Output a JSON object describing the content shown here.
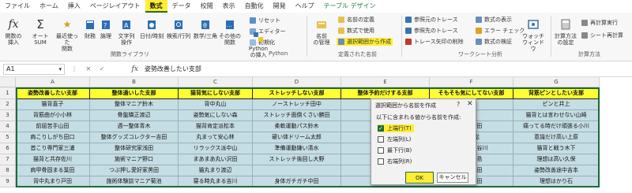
{
  "menu": {
    "items": [
      "ファイル",
      "ホーム",
      "挿入",
      "ページレイアウト",
      "数式",
      "データ",
      "校閲",
      "表示",
      "自動化",
      "開発",
      "ヘルプ",
      "テーブル デザイン"
    ],
    "active_index": 4
  },
  "ribbon": {
    "insert_function": "関数の\n挿入",
    "autosum": "オート\nSUM",
    "recent": "最近使った\n関数",
    "financial": "財務",
    "logical": "論理",
    "text": "文字列\n操作",
    "datetime": "日付/時刻",
    "lookup": "検索/行列",
    "math": "数学/三角",
    "more": "その他の\n関数",
    "group_library": "関数ライブラリ",
    "lambda_items": [
      "リセット",
      "エディター",
      "初期化"
    ],
    "python_insert": "Python\nの挿入",
    "group_python": "Python",
    "name_manager": "名前\nの管理",
    "define_name": "名前の定義",
    "use_in_formula": "数式で使用",
    "create_from_selection": "選択範囲から作成",
    "group_names": "定義された名前",
    "trace_precedents": "参照元のトレース",
    "trace_dependents": "参照先のトレース",
    "remove_arrows": "トレース矢印の削除",
    "show_formulas": "数式の表示",
    "error_check": "エラー チェック",
    "evaluate": "数式の検証",
    "watch": "ウォッチ\nウィンドウ",
    "group_audit": "ワークシート分析",
    "calc_options": "計算方法\nの設定",
    "calc_now": "再計算実行",
    "calc_sheet": "シート再計算",
    "group_calc": "計算方法"
  },
  "formula_bar": {
    "name_box": "A1",
    "fx": "fx",
    "buttons": "⋮ ✕ ✓",
    "value": "姿勢改善したい支部"
  },
  "grid": {
    "columns": [
      "A",
      "B",
      "C",
      "D",
      "E",
      "F",
      "G"
    ],
    "rows": [
      "1",
      "2",
      "3",
      "4",
      "5",
      "6",
      "7",
      "8",
      "9"
    ],
    "headers": [
      "姿勢改善したい支部",
      "整体通いした支部",
      "猫背気にしない支部",
      "ストレッチしない支部",
      "整体予約だけする支部",
      "そもそも気にしてない支部",
      "背筋ピンとしたい支部"
    ],
    "data": [
      [
        "猫背直子",
        "整体マニア鈴木",
        "背中丸山",
        "ノーストレッチ田中",
        "",
        "後藤",
        "ピンと井上"
      ],
      [
        "背筋曲が小小林",
        "骨盤矯正渡辺",
        "姿勢気にしない森",
        "ストレッチ面倒くさい勝田",
        "",
        "猫背",
        "猫背とは言わせない山崎"
      ],
      [
        "前屈苦手山田",
        "週一整体青木",
        "猫背肯定派松本",
        "柔軟運動パス鈴木",
        "カウン",
        "して猫田",
        "痛ってる時だけ頑張る小川"
      ],
      [
        "肩こりしがち田口",
        "整体グッズコレクター吉田",
        "丸まって安心林",
        "硬い体ドリーム太郎",
        "",
        "伸小松",
        "意識だけ高い上原"
      ],
      [
        "首こり専門家三浦",
        "整体研究家浅田",
        "リラックス派中山",
        "準備運動嫌い清水",
        "いつか",
        "計議員長谷川",
        "猫背と戦う木下"
      ],
      [
        "猫背と共存佐川",
        "施術マニア野口",
        "まあまあ丸い沢田",
        "ストレッチ後回し大野",
        "",
        "猫背小島",
        "理想は高い久保"
      ],
      [
        "肩甲骨固まる葉田",
        "つぶ押し愛好家黒田",
        "猫丸まり渡辺",
        "",
        "",
        "いい猫田",
        "姿勢改善途中吉本"
      ],
      [
        "背中丸まり戸田",
        "施術体験談マニア菊池",
        "寝る時丸まる吉川",
        "身体ガチガチ中田",
        "",
        "行政高田",
        "理想はかり石"
      ]
    ]
  },
  "dialog": {
    "title": "選択範囲から名前を作成",
    "help": "?",
    "close": "✕",
    "prompt": "以下に含まれる値から名前を作成:",
    "options": [
      {
        "label": "上端行(T)",
        "checked": true
      },
      {
        "label": "左端列(L)",
        "checked": false
      },
      {
        "label": "最下行(B)",
        "checked": false
      },
      {
        "label": "右端列(R)",
        "checked": false
      }
    ],
    "ok": "OK",
    "cancel": "キャンセル"
  }
}
